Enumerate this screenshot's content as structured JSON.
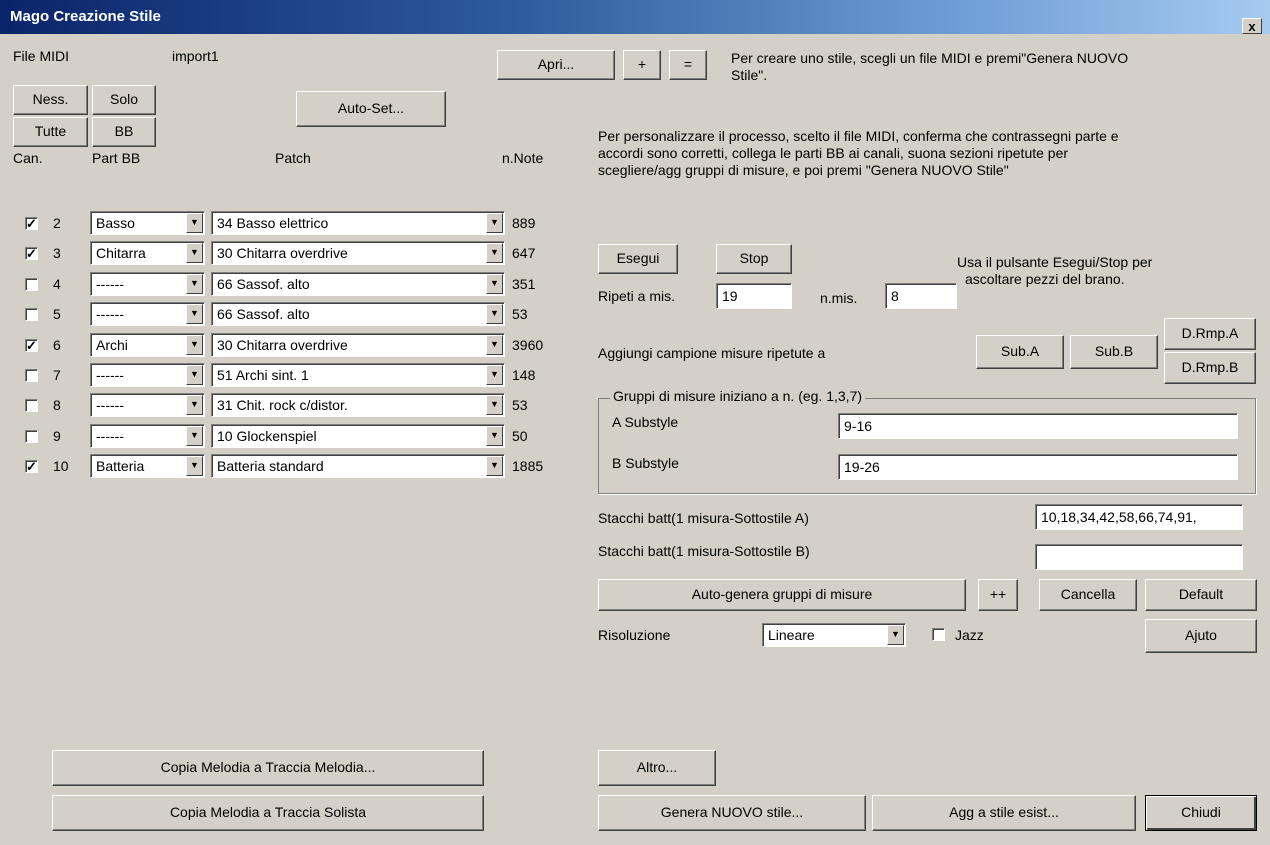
{
  "window": {
    "title": "Mago Creazione Stile",
    "close_label": "x"
  },
  "file": {
    "label": "File MIDI",
    "name": "import1"
  },
  "buttons": {
    "ness": "Ness.",
    "solo": "Solo",
    "tutte": "Tutte",
    "bb": "BB",
    "autoset": "Auto-Set...",
    "apri": "Apri...",
    "plus": "+",
    "equals": "=",
    "esegui": "Esegui",
    "stop": "Stop",
    "suba": "Sub.A",
    "subb": "Sub.B",
    "drmpa": "D.Rmp.A",
    "drmpb": "D.Rmp.B",
    "autogen": "Auto-genera gruppi di misure",
    "plusplus": "++",
    "cancella": "Cancella",
    "default": "Default",
    "ajuto": "Ajuto",
    "copia_melodia": "Copia Melodia a Traccia Melodia...",
    "copia_solista": "Copia Melodia a Traccia Solista",
    "altro": "Altro...",
    "genera": "Genera NUOVO stile...",
    "agg": "Agg a stile esist...",
    "chiudi": "Chiudi"
  },
  "columns": {
    "can": "Can.",
    "part": "Part BB",
    "patch": "Patch",
    "notes": "n.Note"
  },
  "channels": [
    {
      "num": "2",
      "checked": true,
      "part": "Basso",
      "patch": "34 Basso elettrico",
      "notes": "889"
    },
    {
      "num": "3",
      "checked": true,
      "part": "Chitarra",
      "patch": "30 Chitarra overdrive",
      "notes": "647"
    },
    {
      "num": "4",
      "checked": false,
      "part": "------",
      "patch": "66 Sassof. alto",
      "notes": "351"
    },
    {
      "num": "5",
      "checked": false,
      "part": "------",
      "patch": "66 Sassof. alto",
      "notes": "53"
    },
    {
      "num": "6",
      "checked": true,
      "part": "Archi",
      "patch": "30 Chitarra overdrive",
      "notes": "3960"
    },
    {
      "num": "7",
      "checked": false,
      "part": "------",
      "patch": "51 Archi sint. 1",
      "notes": "148"
    },
    {
      "num": "8",
      "checked": false,
      "part": "------",
      "patch": "31 Chit. rock c/distor.",
      "notes": "53"
    },
    {
      "num": "9",
      "checked": false,
      "part": "------",
      "patch": "10 Glockenspiel",
      "notes": "50"
    },
    {
      "num": "10",
      "checked": true,
      "part": "Batteria",
      "patch": "Batteria standard",
      "notes": "1885"
    }
  ],
  "info": {
    "line1": "Per creare uno stile, scegli un file MIDI e premi\"Genera NUOVO",
    "line2": "Stile\".",
    "p1": "Per personalizzare il processo, scelto il file MIDI, conferma che contrassegni parte e",
    "p2": "accordi sono corretti, collega le parti BB ai canali, suona sezioni ripetute per",
    "p3": "scegliere/agg gruppi di misure, e poi premi \"Genera NUOVO Stile\""
  },
  "playback": {
    "hint1": "Usa il pulsante Esegui/Stop per",
    "hint2": "ascoltare pezzi del brano.",
    "repeat_label": "Ripeti a mis.",
    "repeat_value": "19",
    "nmis_label": "n.mis.",
    "nmis_value": "8"
  },
  "sample": {
    "label": "Aggiungi campione misure ripetute a"
  },
  "groups": {
    "title": "Gruppi di misure iniziano a n. (eg. 1,3,7)",
    "a_label": "A Substyle",
    "a_value": "9-16",
    "b_label": "B Substyle",
    "b_value": "19-26"
  },
  "breaks": {
    "a_label": "Stacchi batt(1 misura-Sottostile A)",
    "a_value": "10,18,34,42,58,66,74,91,",
    "b_label": "Stacchi batt(1 misura-Sottostile B)",
    "b_value": ""
  },
  "resolution": {
    "label": "Risoluzione",
    "value": "Lineare",
    "jazz_label": "Jazz",
    "jazz_checked": false
  }
}
